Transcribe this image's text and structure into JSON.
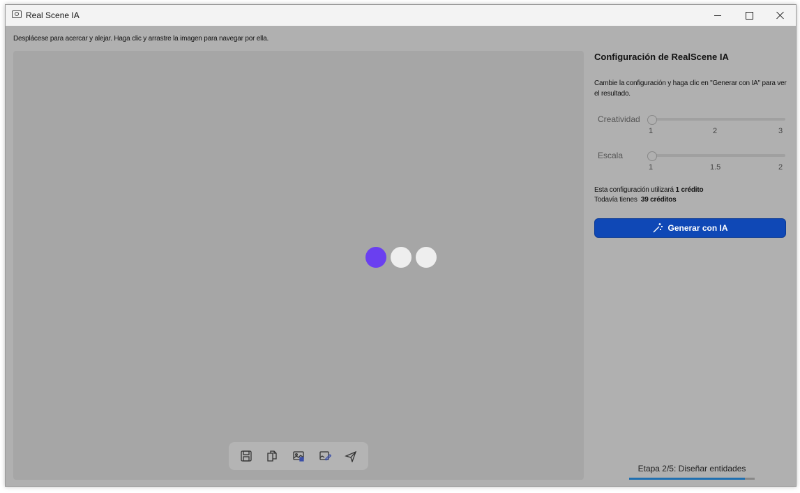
{
  "window": {
    "title": "Real Scene IA"
  },
  "viewer": {
    "hint": "Desplácese para acercar y alejar. Haga clic y arrastre la imagen para navegar por ella.",
    "loader_colors": [
      "#6a3ff0",
      "#eeeeee",
      "#eeeeee"
    ],
    "toolbar": [
      {
        "icon": "save-icon"
      },
      {
        "icon": "copy-icon"
      },
      {
        "icon": "image-export-icon"
      },
      {
        "icon": "edit-image-icon"
      },
      {
        "icon": "send-icon"
      }
    ]
  },
  "panel": {
    "title": "Configuración de RealScene IA",
    "description": "Cambie la configuración y haga clic en \"Generar con IA\" para ver el resultado.",
    "sliders": {
      "creativity": {
        "label": "Creatividad",
        "ticks": [
          "1",
          "2",
          "3"
        ],
        "value": 1
      },
      "scale": {
        "label": "Escala",
        "ticks": [
          "1",
          "1.5",
          "2"
        ],
        "value": 1
      }
    },
    "credits": {
      "line1_prefix": "Esta configuración utilizará",
      "line1_value": "1 crédito",
      "line2_prefix": "Todavía tienes",
      "line2_value": "39 créditos"
    },
    "generate_label": "Generar con IA",
    "accent": "#0f48b6"
  },
  "footer": {
    "stage_label": "Etapa 2/5: Diseñar entidades",
    "stage_progress": 0.92
  }
}
